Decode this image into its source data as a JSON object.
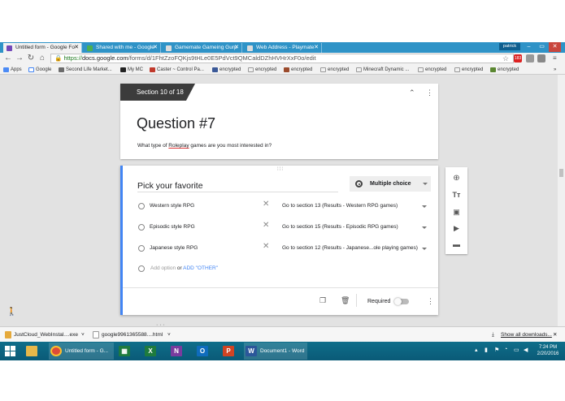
{
  "tabs": [
    {
      "title": "Untitled form - Google Fo",
      "icon": "forms-icon",
      "color": "#7248b9"
    },
    {
      "title": "Shared with me - Google",
      "icon": "drive-icon",
      "color": "#4caf50"
    },
    {
      "title": "Gamemate Gameing Gurp",
      "icon": "doc-icon",
      "color": "#777777"
    },
    {
      "title": "Web Address - Playmate",
      "icon": "doc-icon",
      "color": "#777777"
    }
  ],
  "user": "patrick",
  "url": {
    "scheme": "https://",
    "host": "docs.google.com",
    "path": "/forms/d/1FhtZzoFQKjs9tHLe0E5PdVct9QMCaldDZhHVHrXxF0o/edit"
  },
  "bookmarks": [
    "Apps",
    "Google",
    "Second Life Market...",
    "My MC",
    "Caster ~ Control Pa...",
    "encrypted",
    "encrypted",
    "encrypted",
    "encrypted",
    "Minecraft Dynamic ...",
    "encrypted",
    "encrypted",
    "encrypted"
  ],
  "form": {
    "section_label": "Section 10 of 18",
    "title": "Question #7",
    "description_pre": "What type of ",
    "description_word": "Roleplay",
    "description_post": " games are you most interested in?",
    "question_title": "Pick your favorite",
    "question_type": "Multiple choice",
    "options": [
      {
        "label": "Western style RPG",
        "goto": "Go to section 13 (Results - Western RPG games)"
      },
      {
        "label": "Episodic style RPG",
        "goto": "Go to section 15 (Results - Episodic RPG games)"
      },
      {
        "label": "Japanese style RPG",
        "goto": "Go to section 12 (Results - Japanese...ole playing games)"
      }
    ],
    "add_option": "Add option",
    "or": "or",
    "add_other": "ADD \"OTHER\"",
    "required_label": "Required",
    "required": false
  },
  "downloads": {
    "items": [
      "JustCloud_WebInstal....exe",
      "google9961365588....html"
    ],
    "show_all": "Show all downloads..."
  },
  "taskbar": {
    "items": [
      {
        "label": "",
        "icon": "explorer-icon",
        "color": "#e8b84a"
      },
      {
        "label": "Untitled form - G...",
        "icon": "chrome-icon",
        "color": "#dd4b39"
      },
      {
        "label": "",
        "icon": "spreadsheet-icon",
        "color": "#1e7b3e"
      },
      {
        "label": "",
        "icon": "excel-icon",
        "color": "#1e7b3e"
      },
      {
        "label": "",
        "icon": "onenote-icon",
        "color": "#7a3b9e"
      },
      {
        "label": "",
        "icon": "outlook-icon",
        "color": "#0f6cbd"
      },
      {
        "label": "",
        "icon": "powerpoint-icon",
        "color": "#d04423"
      },
      {
        "label": "Document1 - Word",
        "icon": "word-icon",
        "color": "#2b579a"
      }
    ],
    "time": "7:24 PM",
    "date": "2/20/2016"
  }
}
